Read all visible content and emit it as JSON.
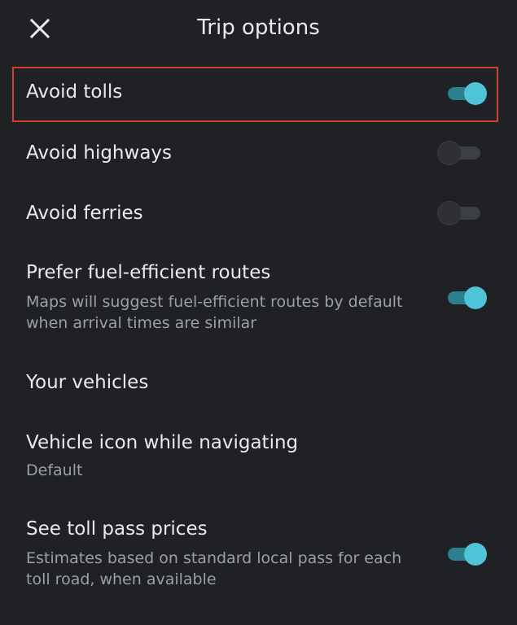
{
  "header": {
    "title": "Trip options",
    "close_icon": "close-icon"
  },
  "options": [
    {
      "label": "Avoid tolls",
      "toggle_on": true
    },
    {
      "label": "Avoid highways",
      "toggle_on": false
    },
    {
      "label": "Avoid ferries",
      "toggle_on": false
    },
    {
      "label": "Prefer fuel-efficient routes",
      "subtitle_line1": "Maps will suggest fuel-efficient routes by default",
      "subtitle_line2": "when arrival times are similar",
      "toggle_on": true
    },
    {
      "label": "Your vehicles"
    },
    {
      "label": "Vehicle icon while navigating",
      "subtitle": "Default"
    },
    {
      "label": "See toll pass prices",
      "subtitle_line1": "Estimates based on standard local pass for each",
      "subtitle_line2": "toll road, when available",
      "toggle_on": true
    }
  ],
  "colors": {
    "background": "#202124",
    "accent": "#4fc3d8",
    "highlight_border": "#d0412c"
  }
}
